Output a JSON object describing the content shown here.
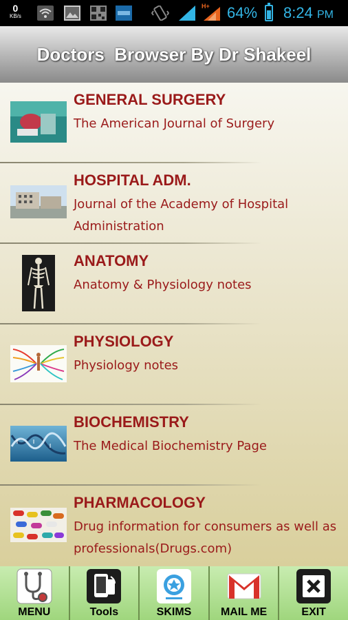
{
  "status_bar": {
    "net_speed_value": "0",
    "net_speed_unit": "KB/s",
    "battery_percent": "64%",
    "time": "8:24",
    "ampm": "PM",
    "signal_label": "H+"
  },
  "header": {
    "title": "Doctors  Browser By Dr Shakeel"
  },
  "list": {
    "items": [
      {
        "title": "GENERAL SURGERY",
        "subtitle": "The American Journal of Surgery"
      },
      {
        "title": "HOSPITAL ADM.",
        "subtitle": "Journal of the Academy of Hospital Administration"
      },
      {
        "title": "ANATOMY",
        "subtitle": "Anatomy & Physiology notes"
      },
      {
        "title": "PHYSIOLOGY",
        "subtitle": "Physiology notes"
      },
      {
        "title": "BIOCHEMISTRY",
        "subtitle": "The Medical Biochemistry Page"
      },
      {
        "title": "PHARMACOLOGY",
        "subtitle": "Drug information for consumers as well as professionals(Drugs.com)"
      }
    ]
  },
  "bottom_bar": {
    "tabs": [
      {
        "label": "MENU",
        "icon": "stethoscope-icon"
      },
      {
        "label": "Tools",
        "icon": "tablet-icon"
      },
      {
        "label": "SKIMS",
        "icon": "skims-logo-icon"
      },
      {
        "label": "MAIL ME",
        "icon": "gmail-icon"
      },
      {
        "label": "EXIT",
        "icon": "exit-icon"
      }
    ]
  },
  "colors": {
    "accent": "#33b5e5",
    "item_text": "#9a1a1a",
    "bottom_bar": "#a8d98a"
  }
}
